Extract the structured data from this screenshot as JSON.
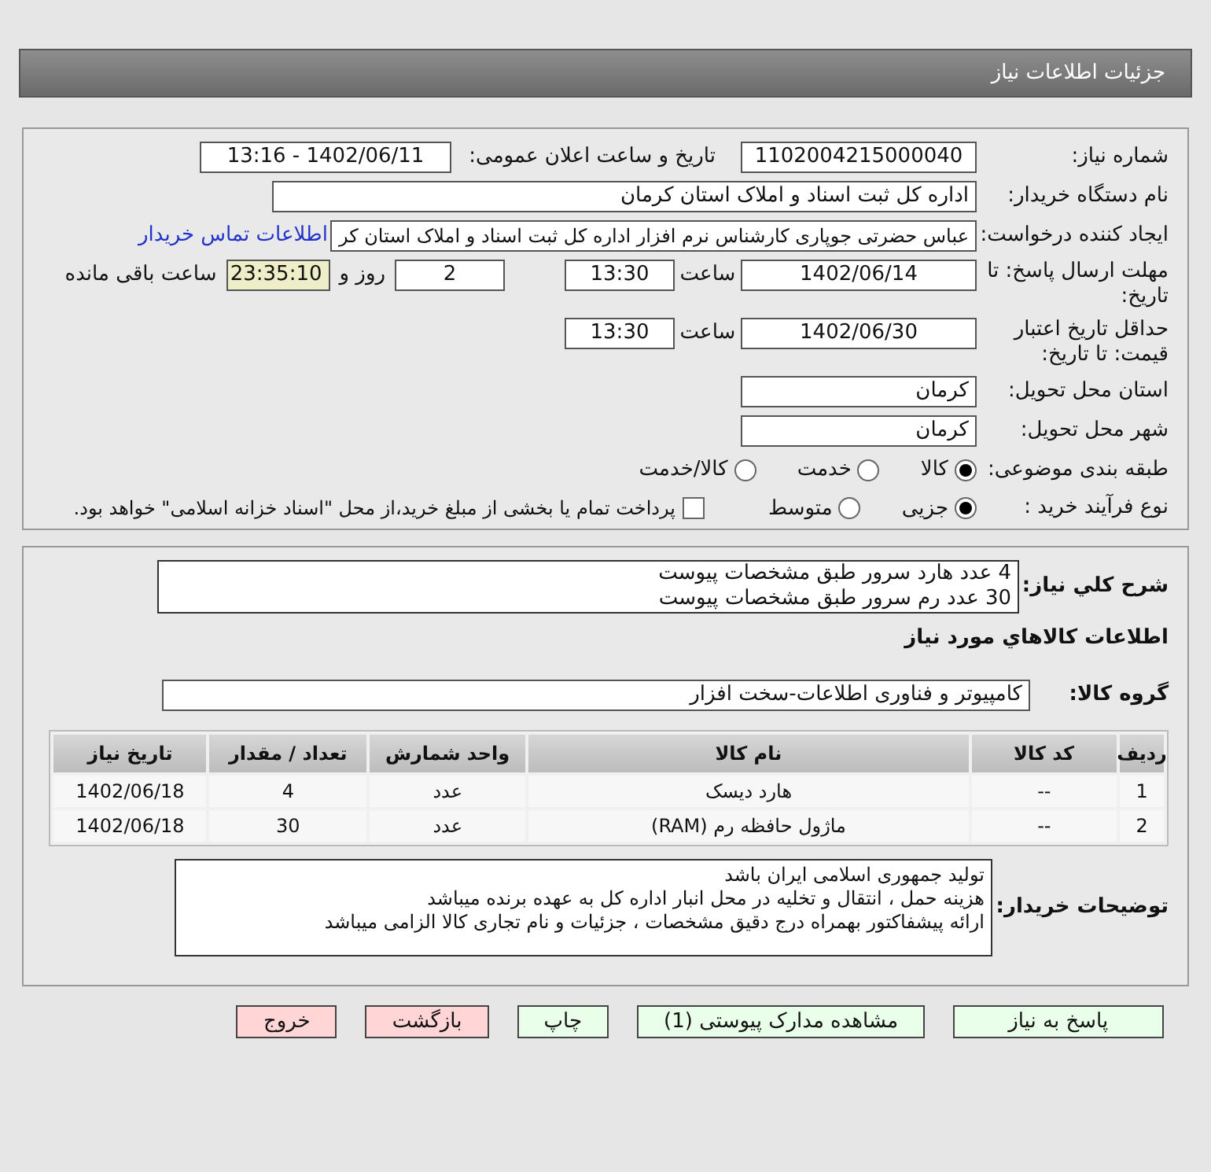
{
  "page_title": "جزئیات اطلاعات نیاز",
  "need_number": {
    "label": "شماره نیاز:",
    "value": "1102004215000040"
  },
  "announce": {
    "label": "تاریخ و ساعت اعلان عمومی:",
    "value": "1402/06/11 - 13:16"
  },
  "buyer_org": {
    "label": "نام دستگاه خریدار:",
    "value": "اداره کل ثبت اسناد و املاک استان کرمان"
  },
  "requester": {
    "label": "ایجاد کننده درخواست:",
    "value": "عباس حضرتی جوپاری کارشناس نرم افزار اداره کل ثبت اسناد و املاک استان کر",
    "link": "اطلاعات تماس خریدار"
  },
  "deadline": {
    "label": "مهلت ارسال پاسخ: تا تاریخ:",
    "date": "1402/06/14",
    "time_label": "ساعت",
    "time": "13:30",
    "days": "2",
    "days_label": "روز و",
    "remaining": "23:35:10",
    "remaining_label": "ساعت باقی مانده"
  },
  "validity": {
    "label": "حداقل تاریخ اعتبار قیمت: تا تاریخ:",
    "date": "1402/06/30",
    "time_label": "ساعت",
    "time": "13:30"
  },
  "province": {
    "label": "استان محل تحویل:",
    "value": "کرمان"
  },
  "city": {
    "label": "شهر محل تحویل:",
    "value": "کرمان"
  },
  "category": {
    "label": "طبقه بندی موضوعی:",
    "options": [
      {
        "label": "کالا",
        "selected": true
      },
      {
        "label": "خدمت",
        "selected": false
      },
      {
        "label": "کالا/خدمت",
        "selected": false
      }
    ]
  },
  "process": {
    "label": "نوع فرآیند خرید :",
    "options": [
      {
        "label": "جزیی",
        "selected": true
      },
      {
        "label": "متوسط",
        "selected": false
      }
    ],
    "payment": {
      "label": "پرداخت تمام یا بخشی از مبلغ خرید،از محل \"اسناد خزانه اسلامی\" خواهد بود.",
      "checked": false
    }
  },
  "summary": {
    "label": "شرح کلي نياز:",
    "lines": [
      "4 عدد هارد سرور طبق مشخصات پیوست",
      "30 عدد رم سرور طبق مشخصات پیوست"
    ]
  },
  "goods_heading": "اطلاعات كالاهاي مورد نياز",
  "goods_group": {
    "label": "گروه کالا:",
    "value": "کامپیوتر و فناوری اطلاعات-سخت افزار"
  },
  "table": {
    "columns": [
      "ردیف",
      "کد کالا",
      "نام کالا",
      "واحد شمارش",
      "تعداد / مقدار",
      "تاریخ نیاز"
    ],
    "rows": [
      [
        "1",
        "--",
        "هارد دیسک",
        "عدد",
        "4",
        "1402/06/18"
      ],
      [
        "2",
        "--",
        "ماژول حافظه رم (RAM)",
        "عدد",
        "30",
        "1402/06/18"
      ]
    ]
  },
  "buyer_notes": {
    "label": "توضیحات خریدار:",
    "lines": [
      "تولید جمهوری اسلامی ایران باشد",
      "هزینه حمل ، انتقال و تخلیه در محل انبار اداره کل به عهده برنده میباشد",
      "ارائه پیشفاکتور بهمراه درج دقیق مشخصات ، جزئیات و نام تجاری کالا الزامی میباشد"
    ]
  },
  "buttons": [
    {
      "label": "پاسخ به نیاز",
      "kind": "normal"
    },
    {
      "label": "مشاهده مدارک پیوستی (1)",
      "kind": "normal"
    },
    {
      "label": "چاپ",
      "kind": "normal"
    },
    {
      "label": "بازگشت",
      "kind": "danger"
    },
    {
      "label": "خروج",
      "kind": "danger"
    }
  ]
}
